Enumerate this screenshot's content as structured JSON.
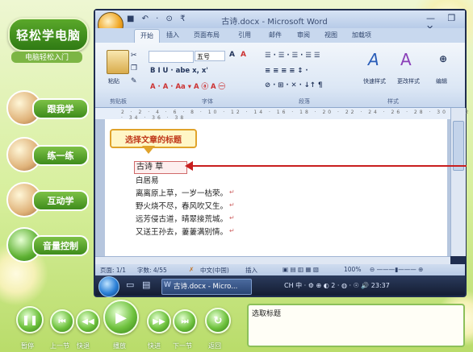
{
  "sidebar": {
    "logo": "轻松学电脑",
    "subtitle": "电脑轻松入门",
    "items": [
      {
        "label": "跟我学"
      },
      {
        "label": "练一练"
      },
      {
        "label": "互动学"
      },
      {
        "label": "音量控制"
      }
    ]
  },
  "window": {
    "quick_access": "■ ↶ · ⊙ ₹",
    "title": "古诗.docx - Microsoft Word",
    "controls": "— ❐ ✕"
  },
  "ribbon": {
    "tabs": [
      "开始",
      "插入",
      "页面布局",
      "引用",
      "邮件",
      "审阅",
      "视图",
      "加载项"
    ],
    "font_size": "五号",
    "groups": [
      "剪贴板",
      "字体",
      "段落",
      "样式"
    ],
    "clipboard_label": "粘贴",
    "style_buttons": [
      "快速样式",
      "更改样式",
      "编辑"
    ],
    "font_tools_row1": "B I U · abe x, x'",
    "font_tools_row2": "A · A · Aa ▾ A ⓐ A ㊀",
    "para_tools_row1": "☰ · ☰ · ☰ · ☰ ☰",
    "para_tools_row2": "≡ ≡ ≡ ≡ ↕ ·",
    "para_tools_row3": "⊘ · ⊞ · ✕ · ↓↑ ¶"
  },
  "ruler": {
    "marks": "2 · 2 · 4 · 6 · 8 · 10 · 12 · 14 · 16 · 18 · 20 · 22 · 24 · 26 · 28 · 30 · 32 · 34 · 36 · 38"
  },
  "document": {
    "callout": "选择文章的标题",
    "title": "古诗 草",
    "lines": [
      "白居易",
      "离离原上草，一岁一枯荣。",
      "野火烧不尽，春风吹又生。",
      "远芳侵古道，晴翠接荒城。",
      "又送王孙去，萋萋满别情。"
    ]
  },
  "status": {
    "page": "页面: 1/1",
    "words": "字数: 4/55",
    "lang": "中文(中国)",
    "mode": "插入",
    "zoom": "100%"
  },
  "taskbar": {
    "item": "古诗.docx - Micro...",
    "tray": "CH 中 ·  ⚙ ⊕ ◐  2 · ◍ · ☉ 🔊 23:37"
  },
  "controls": {
    "buttons": [
      "暂停",
      "上一节",
      "快退",
      "播放",
      "快进",
      "下一节",
      "返回"
    ],
    "caption": "选取标题"
  }
}
